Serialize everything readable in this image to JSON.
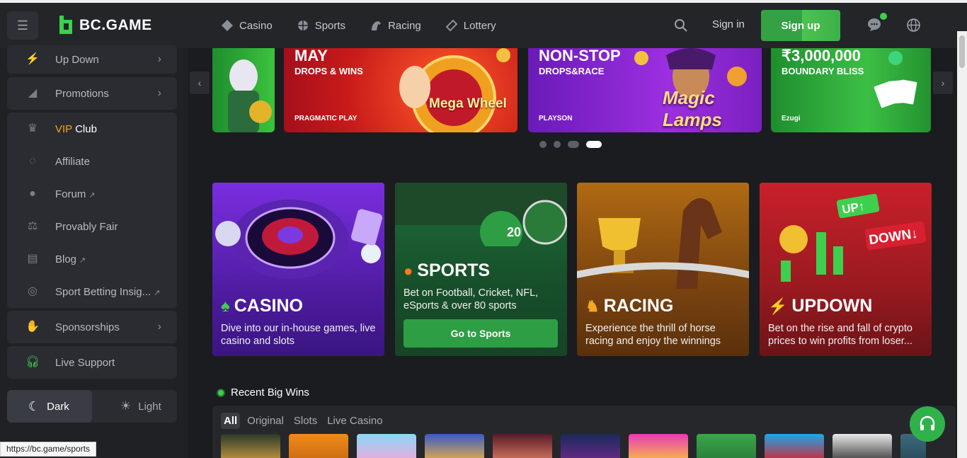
{
  "header": {
    "brand": "BC.GAME",
    "nav": [
      "Casino",
      "Sports",
      "Racing",
      "Lottery"
    ],
    "signin": "Sign in",
    "signup": "Sign up"
  },
  "sidebar": {
    "updown": "Up Down",
    "promotions": "Promotions",
    "vip_prefix": "VIP",
    "vip_suffix": " Club",
    "affiliate": "Affiliate",
    "forum": "Forum",
    "provably_fair": "Provably Fair",
    "blog": "Blog",
    "sport_insights": "Sport Betting Insig...",
    "sponsorships": "Sponsorships",
    "live_support": "Live Support",
    "theme_dark": "Dark",
    "theme_light": "Light"
  },
  "banners": [
    {
      "title": "MAY",
      "subtitle": "DROPS & WINS",
      "brand": "PRAGMATIC PLAY",
      "art": "Mega Wheel"
    },
    {
      "title": "NON-STOP",
      "subtitle": "DROPS&RACE",
      "brand": "PLAYSON",
      "art": "Magic Lamps"
    },
    {
      "title": "₹3,000,000",
      "subtitle": "BOUNDARY BLISS",
      "brand": "Ezugi"
    }
  ],
  "cards": [
    {
      "title": "CASINO",
      "desc": "Dive into our in-house games, live casino and slots"
    },
    {
      "title": "SPORTS",
      "desc": "Bet on Football, Cricket, NFL, eSports & over 80 sports",
      "button": "Go to Sports"
    },
    {
      "title": "RACING",
      "desc": "Experience the thrill of horse racing and enjoy the winnings"
    },
    {
      "title": "UPDOWN",
      "desc": "Bet on the rise and fall of crypto prices to win profits from loser..."
    }
  ],
  "wins": {
    "heading": "Recent Big Wins",
    "tabs": [
      "All",
      "Original",
      "Slots",
      "Live Casino"
    ]
  },
  "status_url": "https://bc.game/sports",
  "colors": {
    "accent": "#34a244",
    "vip": "#f5a623"
  }
}
